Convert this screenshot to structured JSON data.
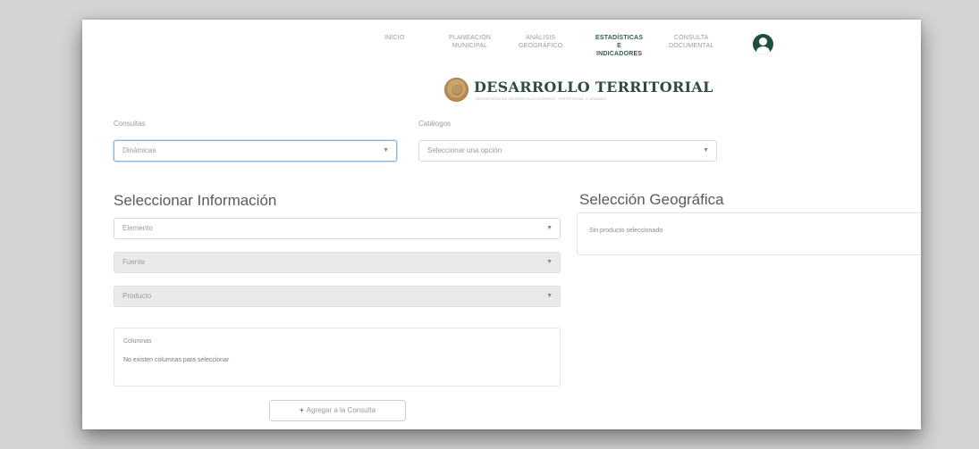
{
  "nav": {
    "items": [
      {
        "lines": [
          "INICIO"
        ]
      },
      {
        "lines": [
          "PLANEACIÓN",
          "MUNICIPAL"
        ]
      },
      {
        "lines": [
          "ANÁLISIS",
          "GEOGRÁFICO"
        ]
      },
      {
        "lines": [
          "ESTADÍSTICAS",
          "E",
          "INDICADORES"
        ],
        "active": true
      },
      {
        "lines": [
          "CONSULTA",
          "DOCUMENTAL"
        ]
      }
    ],
    "avatar_icon": "user-circle-icon",
    "active_color": "#2f5d50"
  },
  "logo": {
    "title": "DESARROLLO TERRITORIAL",
    "subtitle": "SECRETARÍA DE DESARROLLO AGRARIO, TERRITORIAL Y URBANO",
    "icon": "seal-icon"
  },
  "filters": {
    "consultas": {
      "label": "Consultas",
      "value": "Dinámicas"
    },
    "catalogos": {
      "label": "Catálogos",
      "placeholder": "Seleccionar una opción"
    }
  },
  "info": {
    "title": "Seleccionar Información",
    "elemento": "Elemento",
    "fuente": "Fuente",
    "producto": "Producto",
    "columnas_label": "Columnas",
    "columnas_empty": "No existen columnas para seleccionar",
    "add_button": "Agregar a la Consulta"
  },
  "geo": {
    "title": "Selección Geográfica",
    "empty": "Sin producto seleccionado"
  }
}
